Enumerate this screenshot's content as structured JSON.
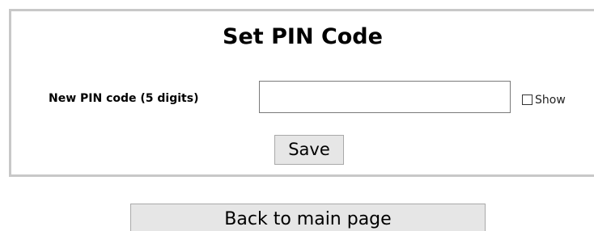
{
  "form": {
    "title": "Set PIN Code",
    "pin_label": "New PIN code (5 digits)",
    "pin_value": "",
    "show_label": "Show",
    "show_checked": false,
    "save_label": "Save"
  },
  "footer": {
    "back_label": "Back to main page"
  },
  "colors": {
    "panel_border": "#c8c8c8",
    "button_background": "#e6e6e6",
    "button_border": "#a9a9a9"
  }
}
